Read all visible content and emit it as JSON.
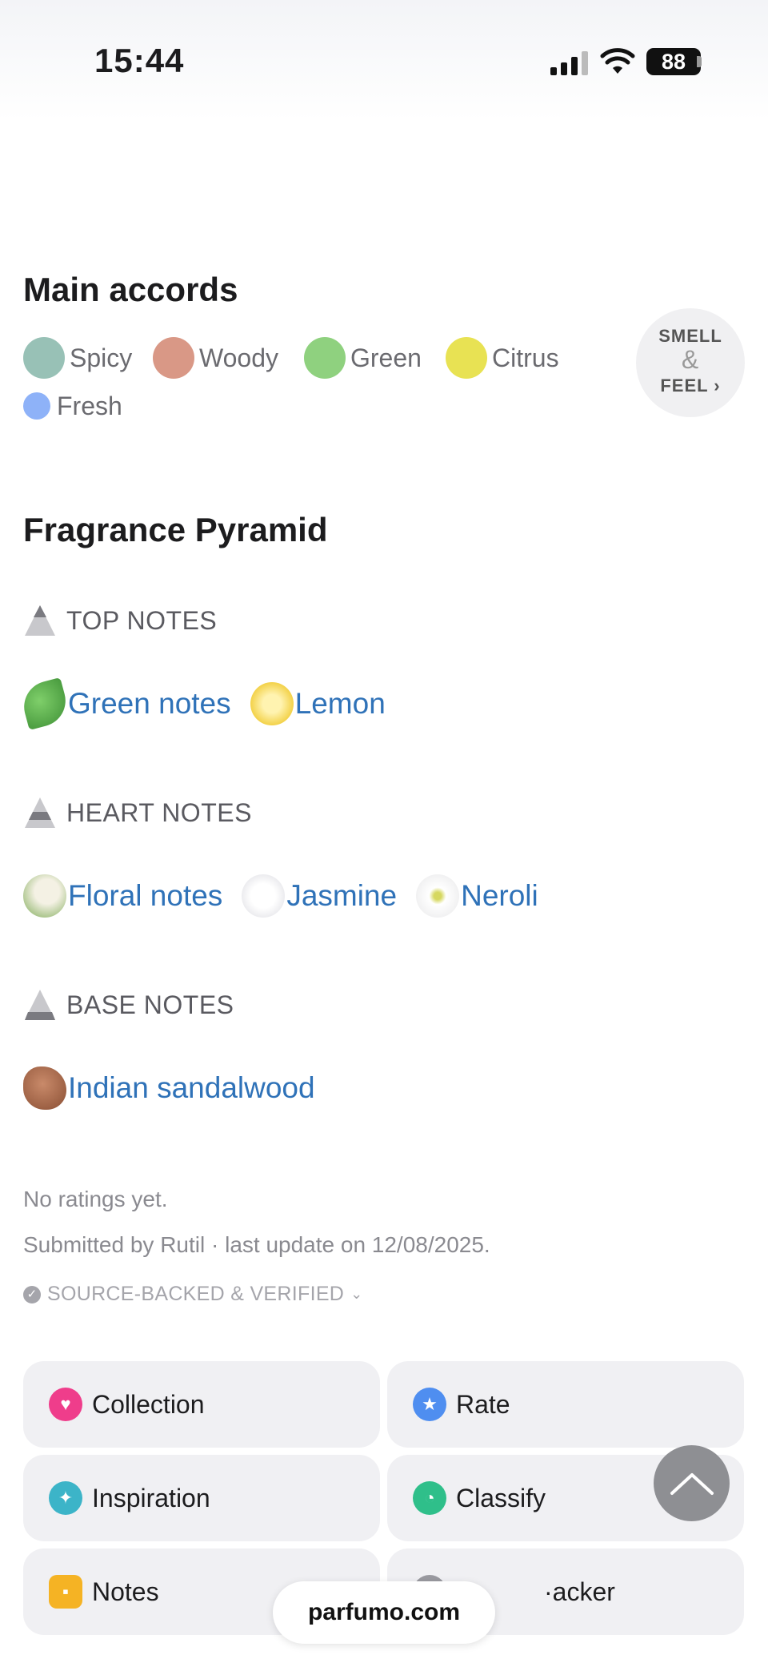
{
  "status_bar": {
    "time": "15:44",
    "battery": "88"
  },
  "accords": {
    "title": "Main accords",
    "items": [
      {
        "label": "Spicy",
        "color": "#98c1b6"
      },
      {
        "label": "Woody",
        "color": "#d99886"
      },
      {
        "label": "Green",
        "color": "#8fd17f"
      },
      {
        "label": "Citrus",
        "color": "#e8e253"
      },
      {
        "label": "Fresh",
        "color": "#8eb2f8"
      }
    ],
    "smell_feel": {
      "line1": "SMELL",
      "amp": "&",
      "line2": "FEEL ›"
    }
  },
  "pyramid": {
    "title": "Fragrance Pyramid",
    "top": {
      "label": "TOP NOTES",
      "notes": [
        {
          "name": "Green notes",
          "icon": "leaf-icon"
        },
        {
          "name": "Lemon",
          "icon": "lemon-icon"
        }
      ]
    },
    "heart": {
      "label": "HEART NOTES",
      "notes": [
        {
          "name": "Floral notes",
          "icon": "flower-bud-icon"
        },
        {
          "name": "Jasmine",
          "icon": "jasmine-icon"
        },
        {
          "name": "Neroli",
          "icon": "neroli-icon"
        }
      ]
    },
    "base": {
      "label": "BASE NOTES",
      "notes": [
        {
          "name": "Indian sandalwood",
          "icon": "wood-icon"
        }
      ]
    }
  },
  "meta": {
    "ratings": "No ratings yet.",
    "submitted": "Submitted by Rutil · last update on 12/08/2025.",
    "verified": "SOURCE-BACKED & VERIFIED"
  },
  "actions": [
    {
      "label": "Collection",
      "icon": "heart-icon",
      "color": "#ef3d8b"
    },
    {
      "label": "Rate",
      "icon": "star-icon",
      "color": "#4f8ef0"
    },
    {
      "label": "Inspiration",
      "icon": "sparkle-icon",
      "color": "#3cb4c8"
    },
    {
      "label": "Classify",
      "icon": "pie-icon",
      "color": "#2fbf8a"
    },
    {
      "label": "Notes",
      "icon": "note-icon",
      "color": "#f5b324"
    },
    {
      "label": "Tracker",
      "visible_text": "·acker",
      "icon": "tracker-icon",
      "color": "#9a9aa0"
    }
  ],
  "site": {
    "domain": "parfumo.com"
  }
}
